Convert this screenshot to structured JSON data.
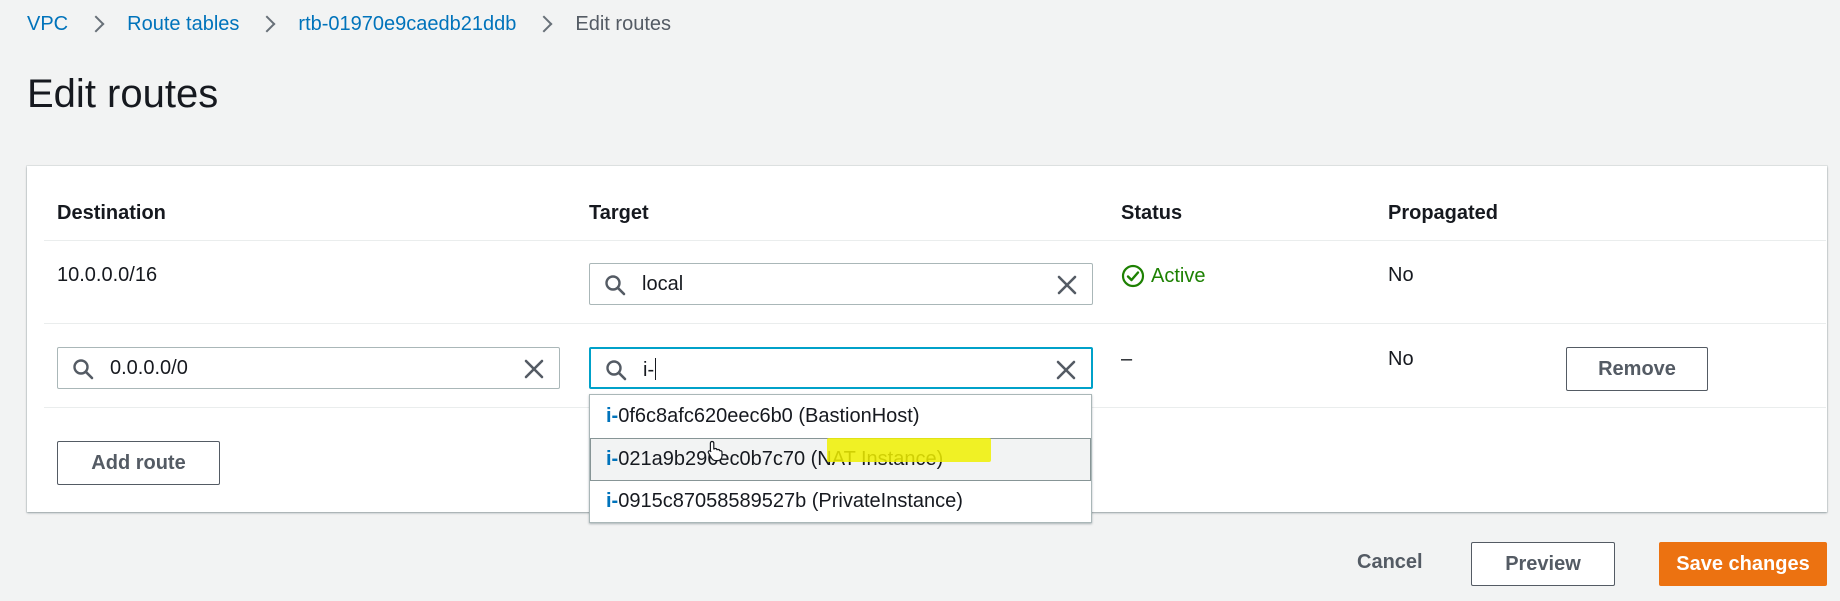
{
  "breadcrumb": {
    "items": [
      "VPC",
      "Route tables",
      "rtb-01970e9caedb21ddb"
    ],
    "current": "Edit routes"
  },
  "page": {
    "title": "Edit routes"
  },
  "table": {
    "headers": {
      "destination": "Destination",
      "target": "Target",
      "status": "Status",
      "propagated": "Propagated"
    },
    "rows": [
      {
        "destination": "10.0.0.0/16",
        "target": "local",
        "status": "Active",
        "propagated": "No"
      },
      {
        "destination": "0.0.0.0/0",
        "target": "i-",
        "status": "–",
        "propagated": "No",
        "remove_label": "Remove"
      }
    ],
    "add_route_label": "Add route"
  },
  "dropdown": {
    "options": [
      {
        "prefix": "i-",
        "rest": "0f6c8afc620eec6b0 (BastionHost)"
      },
      {
        "prefix": "i-",
        "rest": "021a9b296ec0b7c70 (NAT Instance)"
      },
      {
        "prefix": "i-",
        "rest": "0915c87058589527b (PrivateInstance)"
      }
    ]
  },
  "footer": {
    "cancel_label": "Cancel",
    "preview_label": "Preview",
    "save_label": "Save changes"
  },
  "colors": {
    "link": "#0073bb",
    "status_active": "#1d8102",
    "primary_button": "#ec7211",
    "focus_border": "#00a1c9",
    "annotation_highlight": "#f0f000"
  },
  "icons": {
    "search": "search-icon",
    "clear": "close-icon",
    "status": "check-circle-icon",
    "pointer": "hand-cursor-icon"
  }
}
